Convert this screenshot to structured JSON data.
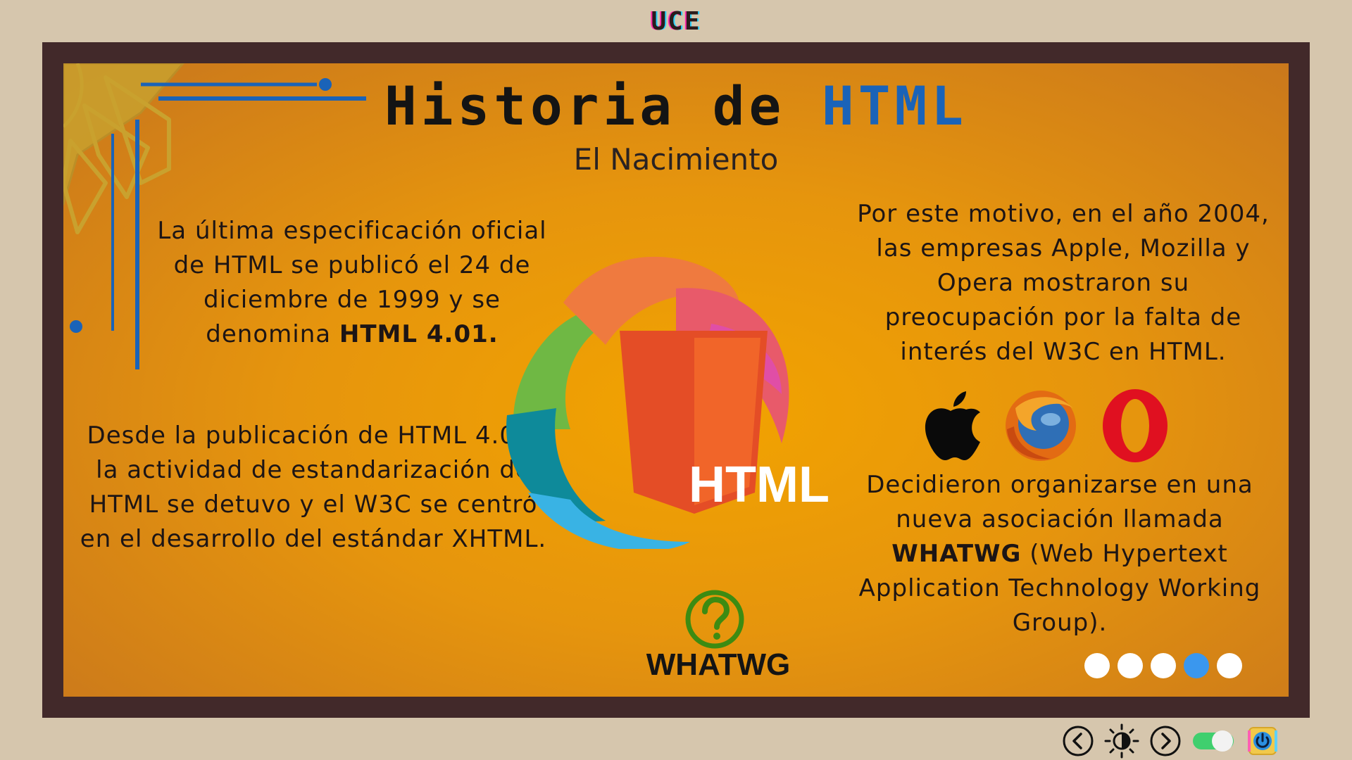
{
  "brand": "UCE",
  "slide": {
    "title_main": "Historia de ",
    "title_accent": "HTML",
    "subtitle": "El Nacimiento",
    "left_paragraph_1": {
      "text": "La última especificación oficial de HTML se publicó el 24 de diciembre de 1999 y se denomina ",
      "bold": "HTML 4.01."
    },
    "left_paragraph_2": "Desde la publicación de HTML 4.01, la actividad de estandarización de HTML se detuvo y el W3C se centró en el desarrollo del estándar XHTML.",
    "right_paragraph_1": "Por este motivo, en el año 2004, las empresas Apple, Mozilla y Opera mostraron su preocupación por la falta de interés del W3C en HTML.",
    "right_paragraph_2": {
      "before": "Decidieron organizarse en una nueva asociación llamada ",
      "bold": "WHATWG",
      "after": " (Web Hypertext Application Technology Working Group)."
    },
    "center_badge": "HTML",
    "whatwg_label": "WHATWG",
    "icons": {
      "center_logo": "html5-shield-icon",
      "question": "question-circle-icon",
      "browsers": [
        "apple-icon",
        "firefox-icon",
        "opera-icon"
      ]
    }
  },
  "pagination": {
    "total": 5,
    "active_index": 3
  },
  "controls": {
    "prev": "chevron-left-icon",
    "theme": "sun-icon",
    "next": "chevron-right-icon",
    "toggle_state": "on",
    "power": "power-icon"
  },
  "colors": {
    "accent_blue": "#1a63b8",
    "frame": "#42292a",
    "background": "#d6c6ad",
    "active_dot": "#3a97ee"
  }
}
